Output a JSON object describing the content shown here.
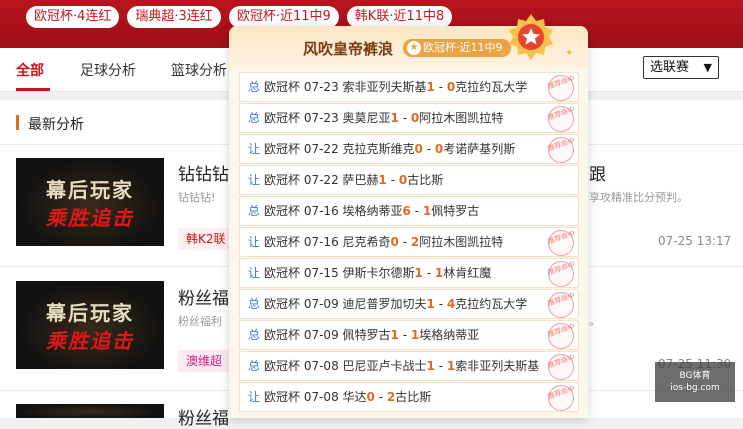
{
  "streak_tags": [
    "欧冠杯·4连红",
    "瑞典超·3连红",
    "欧冠杯·近11中9",
    "韩K联·近11中8"
  ],
  "nav": {
    "tabs": [
      "全部",
      "足球分析",
      "篮球分析"
    ],
    "select_value": "选联赛"
  },
  "section_title": "最新分析",
  "articles": [
    {
      "thumb_line1": "幕后玩家",
      "thumb_line2": "乘胜追击",
      "title": "钻钻钻",
      "title_tail": "跟",
      "desc": "钻钻钻!",
      "desc_tail": "享攻精准比分预判。",
      "tag": "韩K2联",
      "time": "07-25 13:17"
    },
    {
      "thumb_line1": "幕后玩家",
      "thumb_line2": "乘胜追击",
      "title": "粉丝福",
      "desc": "粉丝福利",
      "desc_tail": "。",
      "tag": "澳维超",
      "time": "07-25 11:30"
    },
    {
      "title": "粉丝福"
    }
  ],
  "popup": {
    "title": "风吹皇帝裤浪",
    "badge": "欧冠杯·近11中9",
    "stamp_text": "推荐命中",
    "rows": [
      {
        "kind": "总",
        "text": "欧冠杯 07-23 索非亚列夫斯基",
        "s1": "1",
        "sep": " - ",
        "s2": "0",
        "away": "克拉约瓦大学",
        "hit": true
      },
      {
        "kind": "总",
        "text": "欧冠杯 07-23 奥莫尼亚",
        "s1": "1",
        "sep": " - ",
        "s2": "0",
        "away": "阿拉木图凯拉特",
        "hit": true
      },
      {
        "kind": "让",
        "text": "欧冠杯 07-22 克拉克斯维克",
        "s1": "0",
        "sep": " - ",
        "s2": "0",
        "away": "考诺萨基列斯",
        "hit": true
      },
      {
        "kind": "让",
        "text": "欧冠杯 07-22 萨巴赫",
        "s1": "1",
        "sep": " - ",
        "s2": "0",
        "away": "古比斯",
        "hit": false
      },
      {
        "kind": "总",
        "text": "欧冠杯 07-16 埃格纳蒂亚",
        "s1": "6",
        "sep": " - ",
        "s2": "1",
        "away": "佩特罗古",
        "hit": false
      },
      {
        "kind": "让",
        "text": "欧冠杯 07-16 尼克希奇",
        "s1": "0",
        "sep": " - ",
        "s2": "2",
        "away": "阿拉木图凯拉特",
        "hit": true
      },
      {
        "kind": "让",
        "text": "欧冠杯 07-15 伊斯卡尔德斯",
        "s1": "1",
        "sep": " - ",
        "s2": "1",
        "away": "林肯红魔",
        "hit": true
      },
      {
        "kind": "总",
        "text": "欧冠杯 07-09 迪尼普罗加切夫",
        "s1": "1",
        "sep": " - ",
        "s2": "4",
        "away": "克拉约瓦大学",
        "hit": true
      },
      {
        "kind": "总",
        "text": "欧冠杯 07-09 佩特罗古",
        "s1": "1",
        "sep": " - ",
        "s2": "1",
        "away": "埃格纳蒂亚",
        "hit": true
      },
      {
        "kind": "总",
        "text": "欧冠杯 07-08 巴尼亚卢卡战士",
        "s1": "1",
        "sep": " - ",
        "s2": "1",
        "away": "索非亚列夫斯基",
        "hit": true
      },
      {
        "kind": "让",
        "text": "欧冠杯 07-08 华达",
        "s1": "0",
        "sep": " - ",
        "s2": "2",
        "away": "古比斯",
        "hit": true
      }
    ]
  },
  "watermark": {
    "line1": "BG体育",
    "line2": "ios-bg.com"
  },
  "colors": {
    "brand_red": "#c8161d",
    "score_orange": "#e06a1f",
    "kind_blue": "#3a7bd5",
    "popup_bg": "#fdf6ea"
  }
}
